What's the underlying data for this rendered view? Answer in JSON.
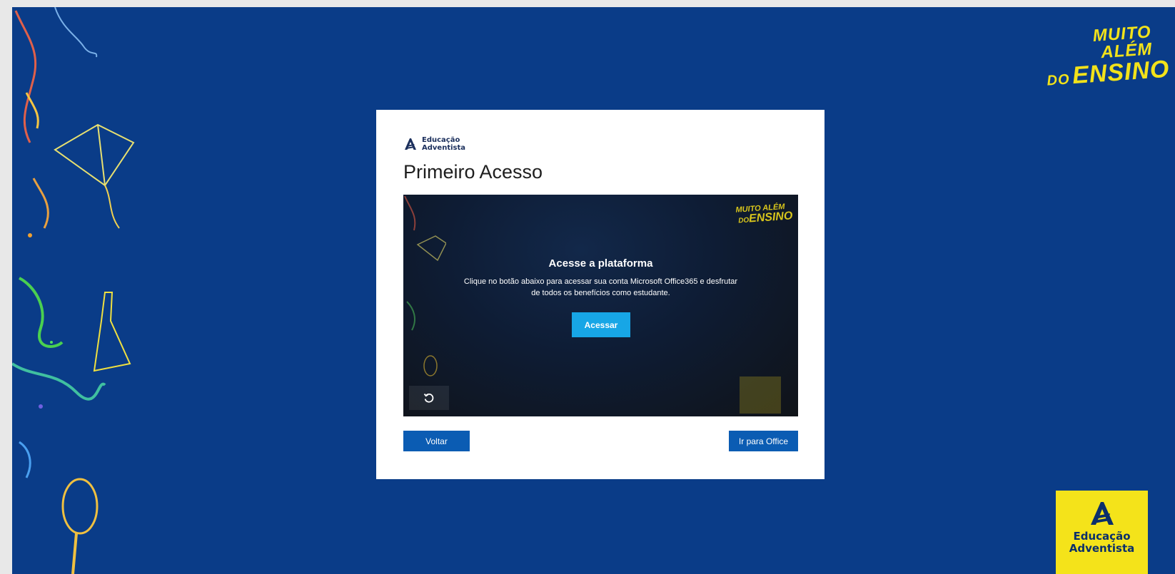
{
  "background": {
    "color": "#0a3c88",
    "slogan": {
      "line1": "MUITO ALÉM",
      "line2_small": "DO",
      "line2": "ENSINO"
    },
    "corner_logo": {
      "line1": "Educação",
      "line2": "Adventista",
      "color": "#f4e31a"
    }
  },
  "card": {
    "brand": {
      "line1": "Educação",
      "line2": "Adventista"
    },
    "title": "Primeiro Acesso",
    "media": {
      "slogan": {
        "line1": "MUITO ALÉM",
        "line2_small": "DO",
        "line2": "ENSINO"
      },
      "heading": "Acesse a plataforma",
      "description": "Clique no botão abaixo para acessar sua conta Microsoft Office365 e desfrutar de todos os benefícios como estudante.",
      "access_label": "Acessar",
      "reload_icon": "reload-icon"
    },
    "back_label": "Voltar",
    "office_label": "Ir para Office"
  },
  "colors": {
    "accent": "#17a6e6",
    "button": "#0b5cb3",
    "slogan": "#f2e21a"
  }
}
